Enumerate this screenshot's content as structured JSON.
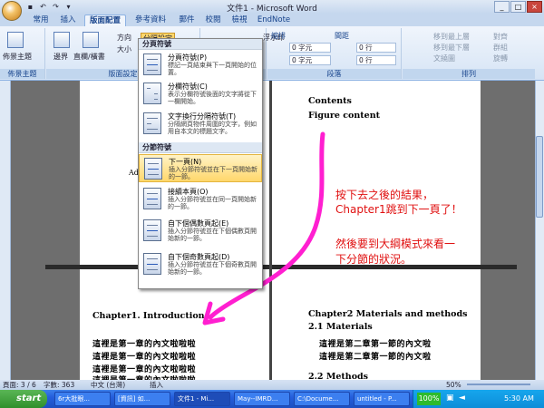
{
  "window": {
    "title": "文件1 - Microsoft Word",
    "controls": [
      "_",
      "□",
      "×"
    ]
  },
  "ribbon_tabs": [
    "常用",
    "插入",
    "版面配置",
    "參考資料",
    "郵件",
    "校閱",
    "檢視",
    "EndNote"
  ],
  "active_tab": "版面配置",
  "ribbon": {
    "themes_label": "佈景主題",
    "group_themes": "佈景主題",
    "group_page_setup": "版面設定",
    "orientation": "方向",
    "size": "大小",
    "margins": "邊界",
    "columns": "直欄/橫書",
    "breaks": "分隔設定",
    "watermark": "浮水印",
    "indent_label": "縮排",
    "spacing_label": "間距",
    "indent_left": "0 字元",
    "indent_right": "0 字元",
    "spacing_before": "0 行",
    "spacing_after": "0 行",
    "group_paragraph": "段落",
    "bring_front": "移到最上層",
    "send_back": "移到最下層",
    "text_wrap": "文繞圖",
    "align": "對齊",
    "group": "群組",
    "rotate": "旋轉",
    "group_arrange": "排列"
  },
  "breaks_menu": {
    "section_page": "分頁符號",
    "section_section": "分節符號",
    "items": [
      {
        "title": "分頁符號(P)",
        "desc": "標記一頁結束與下一頁開始的位置。"
      },
      {
        "title": "分欄符號(C)",
        "desc": "表示分欄符號後面的文字將從下一欄開始。"
      },
      {
        "title": "文字換行分隔符號(T)",
        "desc": "分隔網頁物件周圍的文字，例如用自本文的標題文字。"
      },
      {
        "title": "下一頁(N)",
        "desc": "插入分節符號並在下一頁開始新的一節。"
      },
      {
        "title": "接續本頁(O)",
        "desc": "插入分節符號並在同一頁開始新的一節。"
      },
      {
        "title": "自下個偶數頁起(E)",
        "desc": "插入分節符號並在下個偶數頁開始新的一節。"
      },
      {
        "title": "自下個奇數頁起(D)",
        "desc": "插入分節符號並在下個奇數頁開始新的一節。"
      }
    ]
  },
  "document": {
    "top_right": [
      "Contents",
      "Figure content"
    ],
    "top_left_fragment": "Adv",
    "chapter1_title": "Chapter1. Introduction",
    "chapter1_lines": [
      "這裡是第一章的內文啦啦啦",
      "這裡是第一章的內文啦啦啦",
      "這裡是第一章的內文啦啦啦",
      "這裡是第一章的內文啦啦啦"
    ],
    "chapter2_title": "Chapter2 Materials and methods",
    "materials": "2.1 Materials",
    "chapter2_lines": [
      "這裡是第二章第一節的內文啦",
      "這裡是第二章第一節的內文啦"
    ],
    "methods": "2.2 Methods"
  },
  "annotation": {
    "line1": "按下去之後的結果，",
    "line2": "Chapter1跳到下一頁了！",
    "line3": "然後要到大綱模式來看一",
    "line4": "下分節的狀況。",
    "color": "#e01010",
    "arrow_color": "#ff1fd0"
  },
  "statusbar": {
    "page": "頁面: 3 / 6",
    "words": "字數: 363",
    "language": "中文 (台灣)",
    "mode": "插入",
    "zoom": "50%"
  },
  "taskbar": {
    "start": "start",
    "items": [
      "6r大批眼...",
      "[資訊] 如...",
      "文件1 - Mi...",
      "May--IMRD...",
      "C:\\Docume...",
      "untitled - P..."
    ],
    "battery": "100%",
    "clock": "5:30 AM"
  }
}
